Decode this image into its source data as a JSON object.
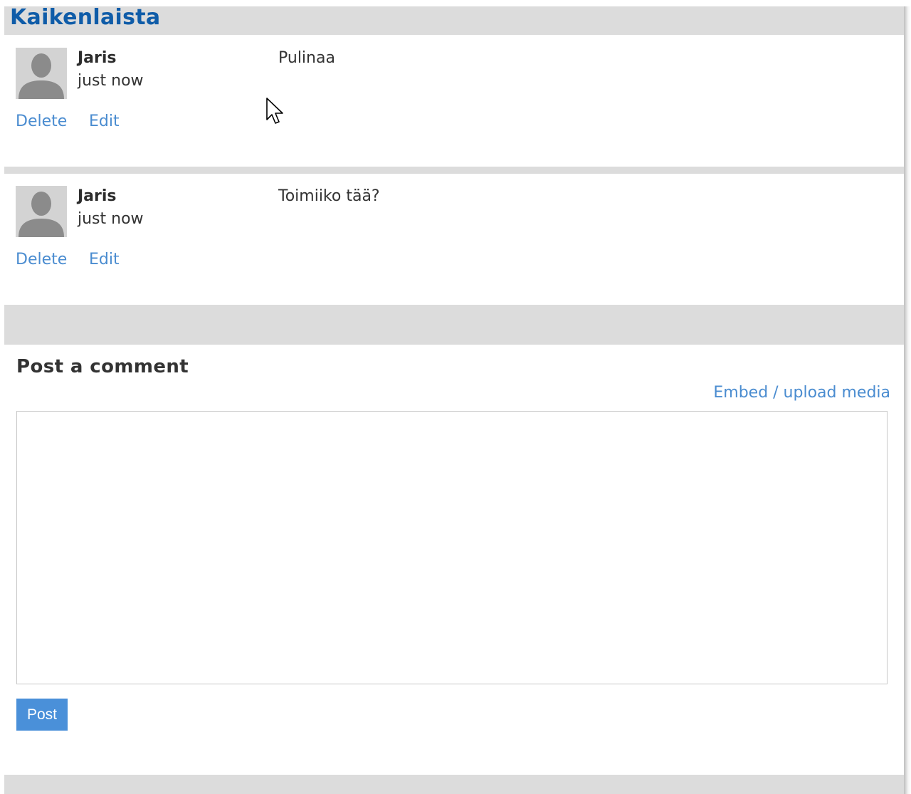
{
  "section": {
    "title": "Kaikenlaista"
  },
  "comments": [
    {
      "author": "Jaris",
      "timestamp": "just now",
      "text": "Pulinaa",
      "delete_label": "Delete",
      "edit_label": "Edit"
    },
    {
      "author": "Jaris",
      "timestamp": "just now",
      "text": "Toimiiko tää?",
      "delete_label": "Delete",
      "edit_label": "Edit"
    }
  ],
  "post_form": {
    "heading": "Post a comment",
    "embed_label": "Embed / upload media",
    "comment_value": "",
    "submit_label": "Post"
  },
  "colors": {
    "title": "#0f5ca8",
    "link": "#4a8cd0",
    "button": "#4a90d9",
    "frame": "#dcdcdc"
  },
  "icons": {
    "avatar": "default-user-silhouette-icon",
    "pointer": "mouse-pointer-icon"
  }
}
